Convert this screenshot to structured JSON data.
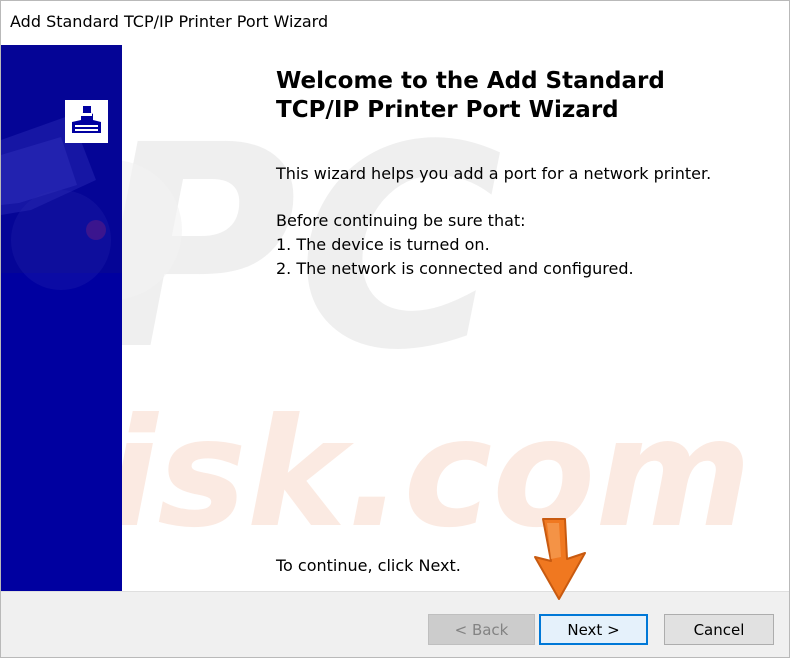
{
  "window": {
    "title": "Add Standard TCP/IP Printer Port Wizard"
  },
  "banner": {
    "icon": "printer-wizard-icon",
    "color": "#0000a0"
  },
  "main": {
    "heading_line1": "Welcome to the Add Standard",
    "heading_line2": "TCP/IP Printer Port Wizard",
    "intro": "This wizard helps you add a port for a network printer.",
    "before_label": "Before continuing be sure that:",
    "items": [
      "1.  The device is turned on.",
      "2.  The network is connected and configured."
    ],
    "continue_text": "To continue, click Next."
  },
  "buttons": {
    "back": "< Back",
    "next": "Next >",
    "cancel": "Cancel"
  },
  "colors": {
    "accent": "#0078d7",
    "arrow": "#f07820"
  },
  "overlay": {
    "watermark_text": "PC risk.com",
    "arrow_icon": "down-arrow-icon"
  }
}
